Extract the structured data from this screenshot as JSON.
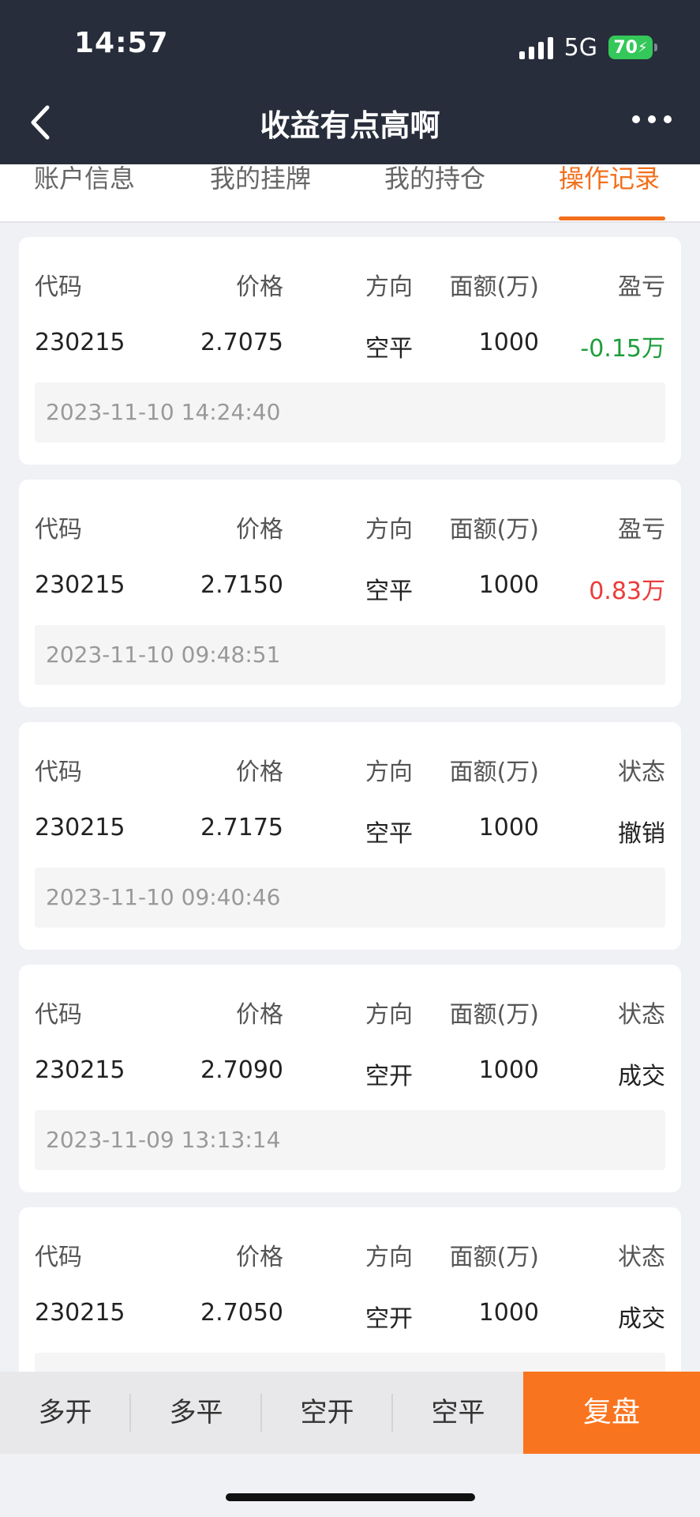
{
  "status": {
    "time": "14:57",
    "network": "5G",
    "battery": "70"
  },
  "nav": {
    "title": "收益有点高啊"
  },
  "tabs": [
    "账户信息",
    "我的挂牌",
    "我的持仓",
    "操作记录"
  ],
  "records": [
    {
      "headers": [
        "代码",
        "价格",
        "方向",
        "面额(万)",
        "盈亏"
      ],
      "code": "230215",
      "price": "2.7075",
      "direction": "空平",
      "amount": "1000",
      "result": "-0.15万",
      "result_color": "#1e9e3c",
      "time": "2023-11-10 14:24:40"
    },
    {
      "headers": [
        "代码",
        "价格",
        "方向",
        "面额(万)",
        "盈亏"
      ],
      "code": "230215",
      "price": "2.7150",
      "direction": "空平",
      "amount": "1000",
      "result": "0.83万",
      "result_color": "#ec3b3b",
      "time": "2023-11-10 09:48:51"
    },
    {
      "headers": [
        "代码",
        "价格",
        "方向",
        "面额(万)",
        "状态"
      ],
      "code": "230215",
      "price": "2.7175",
      "direction": "空平",
      "amount": "1000",
      "result": "撤销",
      "result_color": "#222222",
      "time": "2023-11-10 09:40:46"
    },
    {
      "headers": [
        "代码",
        "价格",
        "方向",
        "面额(万)",
        "状态"
      ],
      "code": "230215",
      "price": "2.7090",
      "direction": "空开",
      "amount": "1000",
      "result": "成交",
      "result_color": "#222222",
      "time": "2023-11-09 13:13:14"
    },
    {
      "headers": [
        "代码",
        "价格",
        "方向",
        "面额(万)",
        "状态"
      ],
      "code": "230215",
      "price": "2.7050",
      "direction": "空开",
      "amount": "1000",
      "result": "成交",
      "result_color": "#222222",
      "time": ""
    }
  ],
  "actions": [
    "多开",
    "多平",
    "空开",
    "空平"
  ],
  "replay_label": "复盘",
  "colors": {
    "accent": "#f26f1c",
    "header_bg": "#272d3b",
    "profit_negative": "#1e9e3c",
    "profit_positive": "#ec3b3b"
  }
}
